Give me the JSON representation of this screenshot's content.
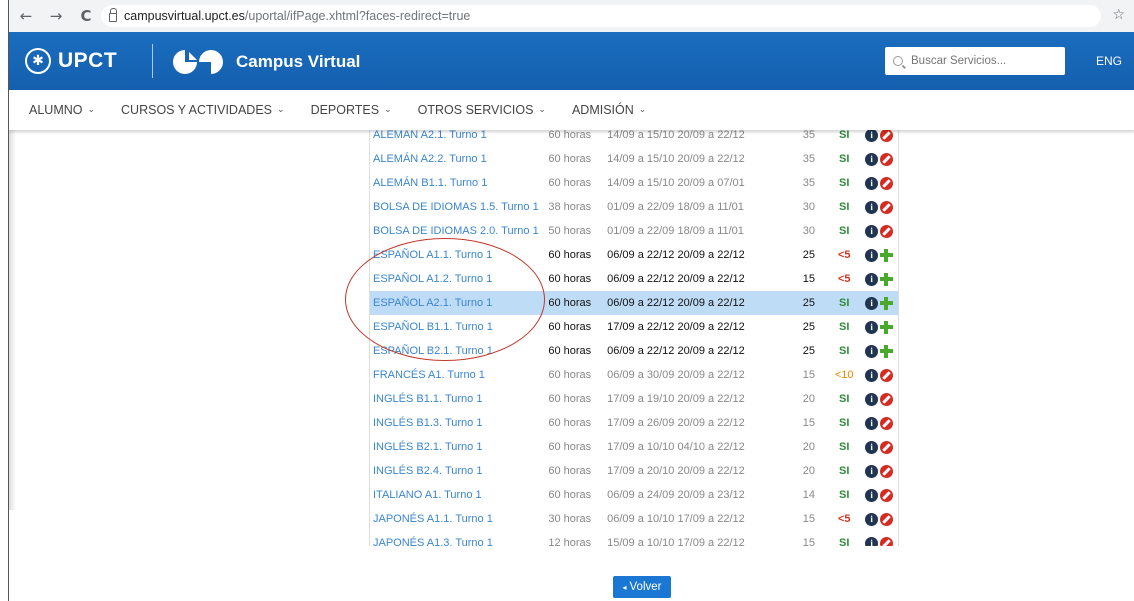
{
  "browser": {
    "back": "←",
    "forward": "→",
    "reload": "C",
    "url_host": "campusvirtual.upct.es",
    "url_path": "/uportal/ifPage.xhtml?faces-redirect=true",
    "star": "☆"
  },
  "header": {
    "brand": "UPCT",
    "app_title": "Campus Virtual",
    "search_placeholder": "Buscar Servicios...",
    "lang": "ENG",
    "color": "#1666b8"
  },
  "menu": [
    {
      "label": "ALUMNO"
    },
    {
      "label": "CURSOS Y ACTIVIDADES"
    },
    {
      "label": "DEPORTES"
    },
    {
      "label": "OTROS SERVICIOS"
    },
    {
      "label": "ADMISIÓN"
    }
  ],
  "courses": [
    {
      "name": "ALEMÁN A2.1. Turno 1",
      "hours": "60 horas",
      "dates": "14/09 a 15/10 20/09 a 22/12",
      "seats": "35",
      "avail": "SI",
      "action": "ban"
    },
    {
      "name": "ALEMÁN A2.2. Turno 1",
      "hours": "60 horas",
      "dates": "14/09 a 15/10 20/09 a 22/12",
      "seats": "35",
      "avail": "SI",
      "action": "ban"
    },
    {
      "name": "ALEMÁN B1.1. Turno 1",
      "hours": "60 horas",
      "dates": "14/09 a 15/10 20/09 a 07/01",
      "seats": "35",
      "avail": "SI",
      "action": "ban"
    },
    {
      "name": "BOLSA DE IDIOMAS 1.5. Turno 1",
      "hours": "38 horas",
      "dates": "01/09 a 22/09 18/09 a 11/01",
      "seats": "30",
      "avail": "SI",
      "action": "ban"
    },
    {
      "name": "BOLSA DE IDIOMAS 2.0. Turno 1",
      "hours": "50 horas",
      "dates": "01/09 a 22/09 18/09 a 11/01",
      "seats": "30",
      "avail": "SI",
      "action": "ban"
    },
    {
      "name": "ESPAÑOL A1.1. Turno 1",
      "hours": "60 horas",
      "dates": "06/09 a 22/12 20/09 a 22/12",
      "seats": "25",
      "avail": "<5",
      "action": "add"
    },
    {
      "name": "ESPAÑOL A1.2. Turno 1",
      "hours": "60 horas",
      "dates": "06/09 a 22/12 20/09 a 22/12",
      "seats": "15",
      "avail": "<5",
      "action": "add"
    },
    {
      "name": "ESPAÑOL A2.1. Turno 1",
      "hours": "60 horas",
      "dates": "06/09 a 22/12 20/09 a 22/12",
      "seats": "25",
      "avail": "SI",
      "action": "add"
    },
    {
      "name": "ESPAÑOL B1.1. Turno 1",
      "hours": "60 horas",
      "dates": "17/09 a 22/12 20/09 a 22/12",
      "seats": "25",
      "avail": "SI",
      "action": "add"
    },
    {
      "name": "ESPAÑOL B2.1. Turno 1",
      "hours": "60 horas",
      "dates": "06/09 a 22/12 20/09 a 22/12",
      "seats": "25",
      "avail": "SI",
      "action": "add"
    },
    {
      "name": "FRANCÉS A1. Turno 1",
      "hours": "60 horas",
      "dates": "06/09 a 30/09 20/09 a 22/12",
      "seats": "15",
      "avail": "<10",
      "action": "ban"
    },
    {
      "name": "INGLÉS B1.1. Turno 1",
      "hours": "60 horas",
      "dates": "17/09 a 19/10 20/09 a 22/12",
      "seats": "20",
      "avail": "SI",
      "action": "ban"
    },
    {
      "name": "INGLÉS B1.3. Turno 1",
      "hours": "60 horas",
      "dates": "17/09 a 26/09 20/09 a 22/12",
      "seats": "15",
      "avail": "SI",
      "action": "ban"
    },
    {
      "name": "INGLÉS B2.1. Turno 1",
      "hours": "60 horas",
      "dates": "17/09 a 10/10 04/10 a 22/12",
      "seats": "20",
      "avail": "SI",
      "action": "ban"
    },
    {
      "name": "INGLÉS B2.4. Turno 1",
      "hours": "60 horas",
      "dates": "17/09 a 20/10 20/09 a 22/12",
      "seats": "20",
      "avail": "SI",
      "action": "ban"
    },
    {
      "name": "ITALIANO A1. Turno 1",
      "hours": "60 horas",
      "dates": "06/09 a 24/09 20/09 a 23/12",
      "seats": "14",
      "avail": "SI",
      "action": "ban"
    },
    {
      "name": "JAPONÉS A1.1. Turno 1",
      "hours": "30 horas",
      "dates": "06/09 a 10/10 17/09 a 22/12",
      "seats": "15",
      "avail": "<5",
      "action": "ban"
    },
    {
      "name": "JAPONÉS A1.3. Turno 1",
      "hours": "12 horas",
      "dates": "15/09 a 10/10 17/09 a 22/12",
      "seats": "15",
      "avail": "SI",
      "action": "ban"
    }
  ],
  "selected_course": "ESPAÑOL A2.1. Turno 1",
  "back_button": "Volver"
}
